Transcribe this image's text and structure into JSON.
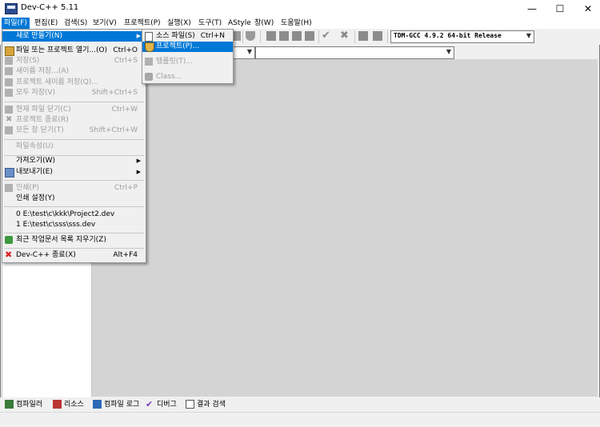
{
  "window": {
    "title": "Dev-C++ 5.11",
    "minimize": "—",
    "maximize": "☐",
    "close": "✕"
  },
  "menubar": [
    "파일(F)",
    "편집(E)",
    "검색(S)",
    "보기(V)",
    "프로젝트(P)",
    "실행(X)",
    "도구(T)",
    "AStyle",
    "창(W)",
    "도움말(H)"
  ],
  "toolbar": {
    "compiler_select": "TDM-GCC 4.9.2 64-bit Release"
  },
  "file_menu": {
    "items": [
      {
        "label": "새로 만들기(N)",
        "shortcut": "",
        "submenu": true,
        "state": "highlighted",
        "icon": "blank"
      },
      {
        "label": "파일 또는 프로젝트 열기...(O)",
        "shortcut": "Ctrl+O",
        "state": "enabled",
        "icon": "folder-open-icon"
      },
      {
        "label": "저장(S)",
        "shortcut": "Ctrl+S",
        "state": "disabled",
        "icon": "save-icon"
      },
      {
        "label": "새이름 저장...(A)",
        "shortcut": "",
        "state": "disabled",
        "icon": "save-as-icon"
      },
      {
        "label": "프로젝트 새이름 저장(Q)...",
        "shortcut": "",
        "state": "disabled",
        "icon": "save-project-icon"
      },
      {
        "label": "모두 저장(V)",
        "shortcut": "Shift+Ctrl+S",
        "state": "disabled",
        "icon": "save-all-icon"
      },
      {
        "label": "현재 파일 닫기(C)",
        "shortcut": "Ctrl+W",
        "state": "disabled",
        "icon": "close-file-icon"
      },
      {
        "label": "프로젝트 종료(R)",
        "shortcut": "",
        "state": "disabled",
        "icon": "close-project-icon"
      },
      {
        "label": "모든 창 닫기(T)",
        "shortcut": "Shift+Ctrl+W",
        "state": "disabled",
        "icon": "close-all-icon"
      },
      {
        "label": "파일속성(U)",
        "shortcut": "",
        "state": "disabled",
        "icon": "none"
      },
      {
        "label": "가져오기(W)",
        "shortcut": "",
        "submenu": true,
        "state": "enabled",
        "icon": "none"
      },
      {
        "label": "내보내기(E)",
        "shortcut": "",
        "submenu": true,
        "state": "enabled",
        "icon": "export-icon"
      },
      {
        "label": "인쇄(P)",
        "shortcut": "Ctrl+P",
        "state": "disabled",
        "icon": "print-icon"
      },
      {
        "label": "인쇄 설정(Y)",
        "shortcut": "",
        "state": "enabled",
        "icon": "none"
      },
      {
        "label": "0 E:\\test\\c\\kkk\\Project2.dev",
        "shortcut": "",
        "state": "enabled",
        "icon": "none"
      },
      {
        "label": "1 E:\\test\\c\\sss\\sss.dev",
        "shortcut": "",
        "state": "enabled",
        "icon": "none"
      },
      {
        "label": "최근 작업문서 목록 지우기(Z)",
        "shortcut": "",
        "state": "enabled",
        "icon": "trash-icon"
      },
      {
        "label": "Dev-C++ 종료(X)",
        "shortcut": "Alt+F4",
        "state": "enabled",
        "icon": "exit-icon"
      }
    ]
  },
  "new_submenu": {
    "items": [
      {
        "label": "소스 파일(S)",
        "shortcut": "Ctrl+N",
        "state": "enabled",
        "icon": "source-file-icon"
      },
      {
        "label": "프로젝트(P)...",
        "shortcut": "",
        "state": "highlighted",
        "icon": "project-icon"
      },
      {
        "label": "템플릿(T)...",
        "shortcut": "",
        "state": "disabled",
        "icon": "template-icon"
      },
      {
        "label": "Class...",
        "shortcut": "",
        "state": "disabled",
        "icon": "class-icon"
      }
    ]
  },
  "bottom_tabs": [
    "컴파일러",
    "리소스",
    "컴파일 로그",
    "디버그",
    "결과 검색"
  ],
  "colors": {
    "highlight": "#0078d7",
    "editor_bg": "#d4d4d4",
    "disabled_text": "#9d9d9d"
  }
}
